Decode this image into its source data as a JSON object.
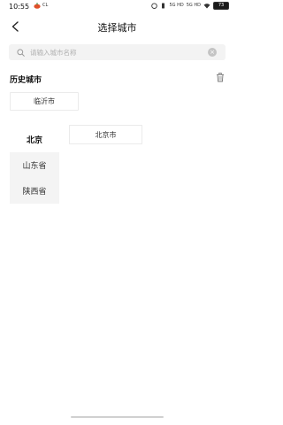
{
  "status_bar": {
    "time": "10:55",
    "carrier_badge": "CL",
    "signal_text_1": "5G HD",
    "signal_text_2": "5G HD",
    "battery": "73"
  },
  "header": {
    "title": "选择城市",
    "back_icon": "chevron-left-icon"
  },
  "search": {
    "placeholder": "请输入城市名称",
    "value": ""
  },
  "history": {
    "title": "历史城市",
    "items": [
      "临沂市"
    ]
  },
  "provinces": {
    "items": [
      "北京",
      "山东省",
      "陕西省"
    ],
    "selected": "北京"
  },
  "cities": {
    "items": [
      "北京市"
    ]
  }
}
